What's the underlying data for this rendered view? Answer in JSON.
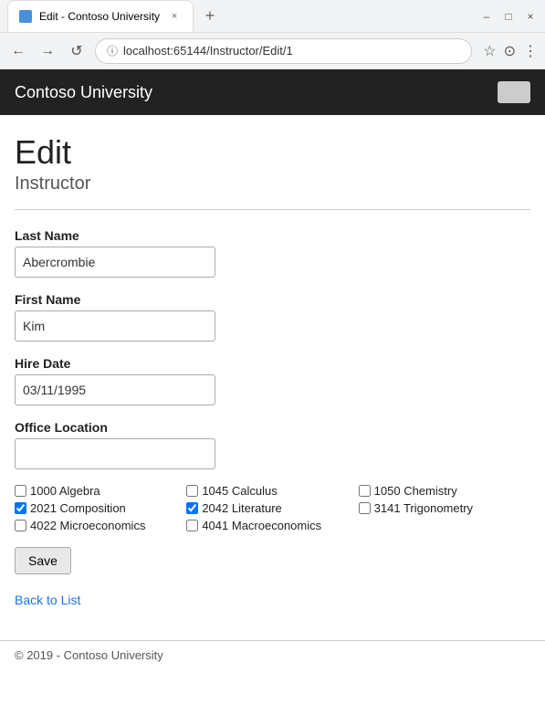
{
  "browser": {
    "tab_title": "Edit - Contoso University",
    "tab_close": "×",
    "new_tab": "+",
    "window_minimize": "–",
    "window_maximize": "□",
    "window_close": "×",
    "nav_back": "←",
    "nav_forward": "→",
    "nav_refresh": "↺",
    "address_url": "localhost:65144/Instructor/Edit/1",
    "address_star": "☆",
    "address_account": "⊙",
    "address_menu": "⋮"
  },
  "header": {
    "title": "Contoso University"
  },
  "page": {
    "heading": "Edit",
    "subtitle": "Instructor"
  },
  "form": {
    "last_name_label": "Last Name",
    "last_name_value": "Abercrombie",
    "first_name_label": "First Name",
    "first_name_value": "Kim",
    "hire_date_label": "Hire Date",
    "hire_date_value": "03/11/1995",
    "office_location_label": "Office Location",
    "office_location_value": ""
  },
  "courses": [
    {
      "id": "1000",
      "name": "Algebra",
      "checked": false
    },
    {
      "id": "1045",
      "name": "Calculus",
      "checked": false
    },
    {
      "id": "1050",
      "name": "Chemistry",
      "checked": false
    },
    {
      "id": "2021",
      "name": "Composition",
      "checked": true
    },
    {
      "id": "2042",
      "name": "Literature",
      "checked": true
    },
    {
      "id": "3141",
      "name": "Trigonometry",
      "checked": false
    },
    {
      "id": "4022",
      "name": "Microeconomics",
      "checked": false
    },
    {
      "id": "4041",
      "name": "Macroeconomics",
      "checked": false
    }
  ],
  "buttons": {
    "save_label": "Save"
  },
  "links": {
    "back_to_list": "Back to List"
  },
  "footer": {
    "copyright": "© 2019 - Contoso University"
  }
}
